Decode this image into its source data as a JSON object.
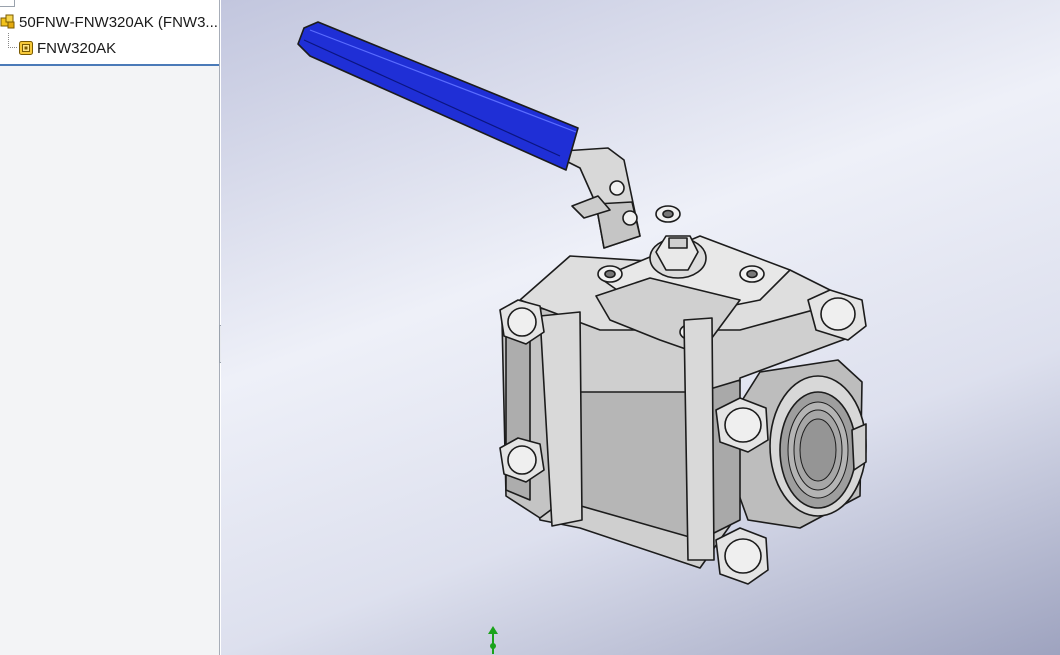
{
  "feature_tree": {
    "root_label": "50FNW-FNW320AK  (FNW3...",
    "root_icon": "assembly-icon",
    "child_label": "FNW320AK",
    "child_icon": "part-icon"
  },
  "viewport": {
    "model": "ball-valve",
    "handle_color": "#1f2fd6",
    "body_color": "#c9c9c9",
    "edge_color": "#1c1c1c",
    "triad_icon": "y-axis-triad-icon"
  },
  "colors": {
    "panel_bg": "#f3f4f6",
    "selection_border": "#4a7ab8",
    "viewport_top": "#eef0f8",
    "viewport_bottom": "#9ea3bf"
  }
}
